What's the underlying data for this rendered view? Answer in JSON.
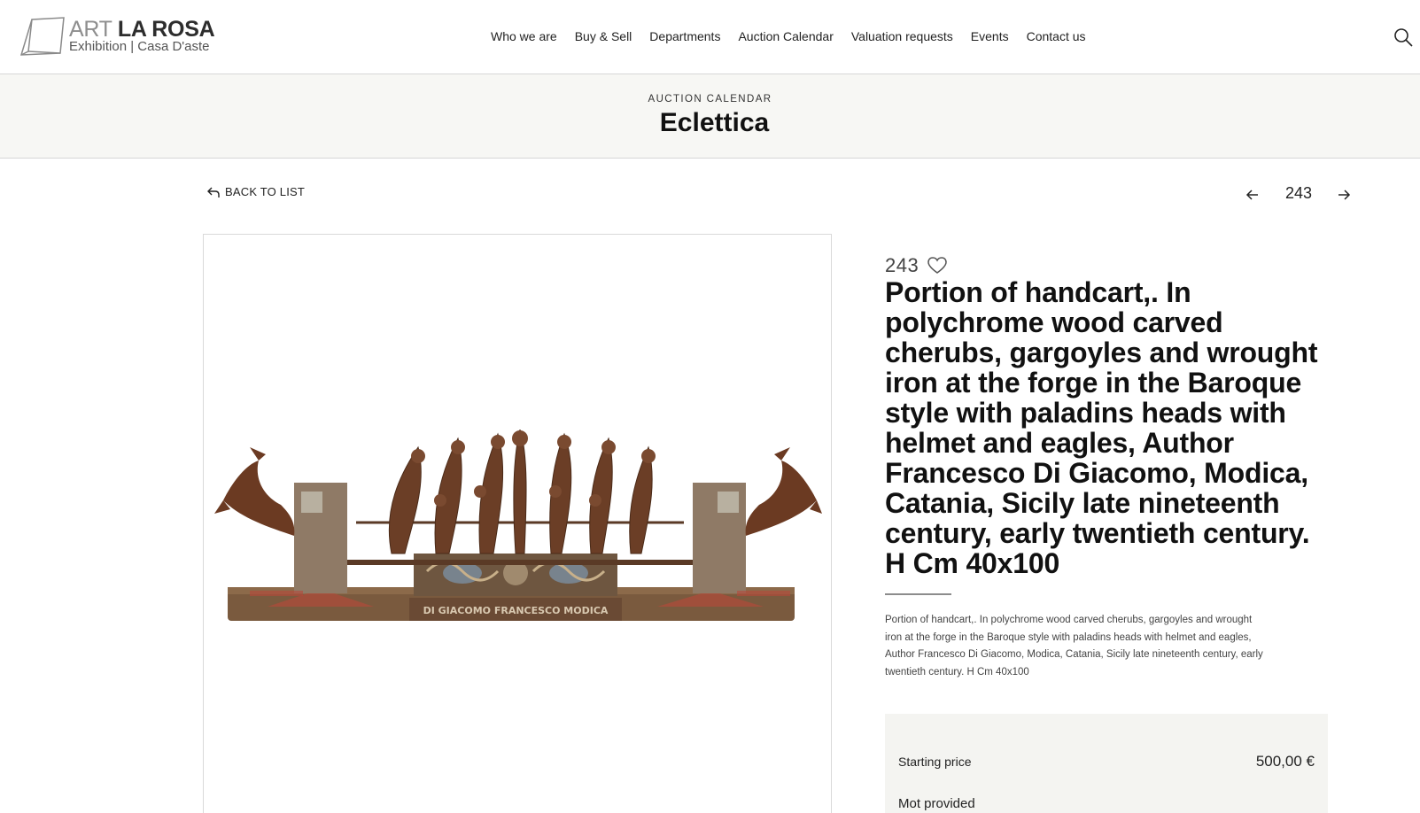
{
  "brand": {
    "name_part1": "ART",
    "name_part2": "LA ROSA",
    "tagline": "Exhibition | Casa D'aste"
  },
  "nav": {
    "items": [
      "Who we are",
      "Buy & Sell",
      "Departments",
      "Auction Calendar",
      "Valuation requests",
      "Events",
      "Contact us"
    ],
    "search_icon": "search-icon"
  },
  "band": {
    "kicker": "AUCTION CALENDAR",
    "title": "Eclettica"
  },
  "subnav": {
    "back_label": "BACK TO LIST",
    "lot_number": "243"
  },
  "lot": {
    "number": "243",
    "title": "Portion of handcart,. In polychrome wood carved cherubs, gargoyles and wrought iron at the forge in the Baroque style with paladins heads with helmet and eagles, Author Francesco Di Giacomo, Modica, Catania, Sicily late nineteenth century, early twentieth century. H Cm 40x100",
    "description": "Portion of handcart,. In polychrome wood carved cherubs, gargoyles and wrought iron at the forge in the Baroque style with paladins heads with helmet and eagles, Author Francesco Di Giacomo, Modica, Catania, Sicily late nineteenth century, early twentieth century. H Cm 40x100",
    "artwork_inscription": "DI GIACOMO FRANCESCO MODICA"
  },
  "price": {
    "starting_label": "Starting price",
    "starting_value": "500,00 €",
    "estimate_label": "Mot provided"
  },
  "colors": {
    "band_bg": "#f7f7f4",
    "price_bg": "#f4f4f1",
    "border": "#d6d6d6",
    "text": "#1a1a1a"
  }
}
